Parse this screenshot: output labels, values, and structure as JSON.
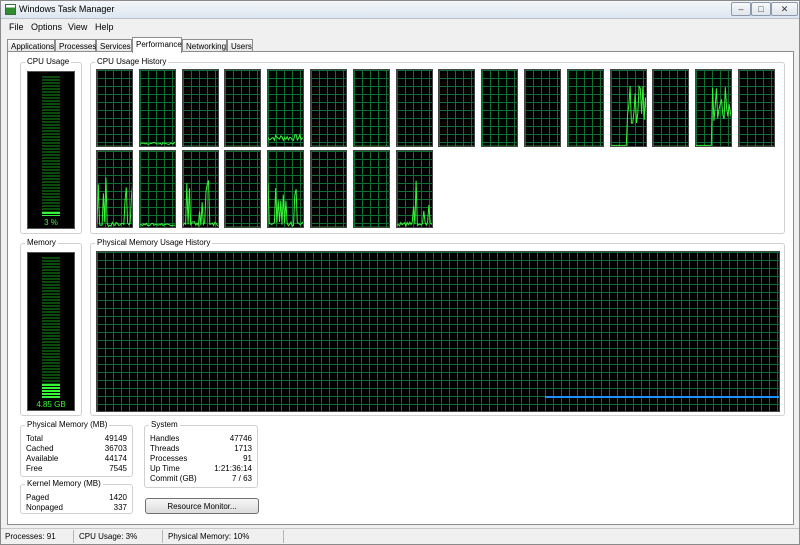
{
  "window": {
    "title": "Windows Task Manager"
  },
  "menu": [
    "File",
    "Options",
    "View",
    "Help"
  ],
  "tabs": [
    {
      "label": "Applications",
      "active": false
    },
    {
      "label": "Processes",
      "active": false
    },
    {
      "label": "Services",
      "active": false
    },
    {
      "label": "Performance",
      "active": true
    },
    {
      "label": "Networking",
      "active": false
    },
    {
      "label": "Users",
      "active": false
    }
  ],
  "cpu_usage": {
    "label": "CPU Usage",
    "value": "3 %",
    "percent": 3
  },
  "cpu_history": {
    "label": "CPU Usage History",
    "cores": [
      {
        "activity": "flat"
      },
      {
        "activity": "low"
      },
      {
        "activity": "flat"
      },
      {
        "activity": "flat"
      },
      {
        "activity": "medium"
      },
      {
        "activity": "flat"
      },
      {
        "activity": "flat"
      },
      {
        "activity": "flat"
      },
      {
        "activity": "flat"
      },
      {
        "activity": "flat"
      },
      {
        "activity": "flat"
      },
      {
        "activity": "flat"
      },
      {
        "activity": "high"
      },
      {
        "activity": "flat"
      },
      {
        "activity": "high"
      },
      {
        "activity": "flat"
      },
      {
        "activity": "spiky"
      },
      {
        "activity": "low"
      },
      {
        "activity": "spiky"
      },
      {
        "activity": "flat"
      },
      {
        "activity": "spiky"
      },
      {
        "activity": "flat"
      },
      {
        "activity": "flat"
      },
      {
        "activity": "spiky"
      }
    ]
  },
  "memory": {
    "label": "Memory",
    "value": "4.85 GB",
    "fraction": 0.1
  },
  "memory_history": {
    "label": "Physical Memory Usage History",
    "line_color": "#1e90ff"
  },
  "physical_memory": {
    "label": "Physical Memory (MB)",
    "rows": [
      {
        "k": "Total",
        "v": "49149"
      },
      {
        "k": "Cached",
        "v": "36703"
      },
      {
        "k": "Available",
        "v": "44174"
      },
      {
        "k": "Free",
        "v": "7545"
      }
    ]
  },
  "kernel_memory": {
    "label": "Kernel Memory (MB)",
    "rows": [
      {
        "k": "Paged",
        "v": "1420"
      },
      {
        "k": "Nonpaged",
        "v": "337"
      }
    ]
  },
  "system": {
    "label": "System",
    "rows": [
      {
        "k": "Handles",
        "v": "47746"
      },
      {
        "k": "Threads",
        "v": "1713"
      },
      {
        "k": "Processes",
        "v": "91"
      },
      {
        "k": "Up Time",
        "v": "1:21:36:14"
      },
      {
        "k": "Commit (GB)",
        "v": "7 / 63"
      }
    ]
  },
  "resource_monitor_button": "Resource Monitor...",
  "status": {
    "processes": "Processes: 91",
    "cpu": "CPU Usage: 3%",
    "memory": "Physical Memory: 10%"
  },
  "colors": {
    "grid": "#0f6e32",
    "graph_line": "#37f437",
    "memory_line": "#1e90ff",
    "background": "#000000"
  }
}
